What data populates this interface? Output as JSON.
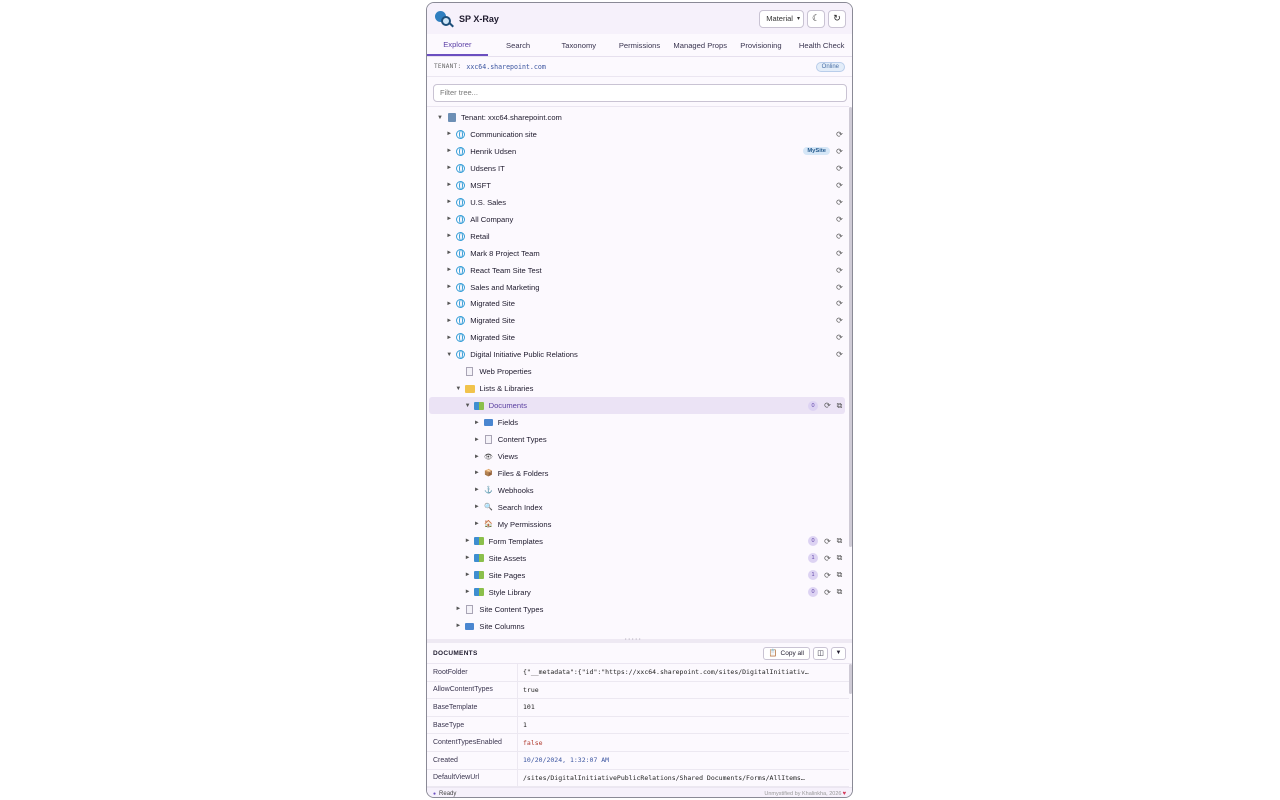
{
  "app": {
    "title": "SP X-Ray",
    "theme": "Material"
  },
  "tabs": [
    "Explorer",
    "Search",
    "Taxonomy",
    "Permissions",
    "Managed Props",
    "Provisioning",
    "Health Check"
  ],
  "tenant": {
    "label": "TENANT:",
    "url": "xxc64.sharepoint.com",
    "status": "Online"
  },
  "filter": {
    "placeholder": "Filter tree...",
    "value": ""
  },
  "tree": [
    {
      "label": "Tenant: xxc64.sharepoint.com",
      "icon": "building-icon",
      "depth": 0,
      "arrow": "▼"
    },
    {
      "label": "Communication site",
      "icon": "globe-icon",
      "depth": 1,
      "arrow": "►",
      "refresh": true
    },
    {
      "label": "Henrik Udsen",
      "icon": "globe-icon",
      "depth": 1,
      "arrow": "►",
      "refresh": true,
      "badge": "MySite"
    },
    {
      "label": "Udsens IT",
      "icon": "globe-icon",
      "depth": 1,
      "arrow": "►",
      "refresh": true
    },
    {
      "label": "MSFT",
      "icon": "globe-icon",
      "depth": 1,
      "arrow": "►",
      "refresh": true
    },
    {
      "label": "U.S. Sales",
      "icon": "globe-icon",
      "depth": 1,
      "arrow": "►",
      "refresh": true
    },
    {
      "label": "All Company",
      "icon": "globe-icon",
      "depth": 1,
      "arrow": "►",
      "refresh": true
    },
    {
      "label": "Retail",
      "icon": "globe-icon",
      "depth": 1,
      "arrow": "►",
      "refresh": true
    },
    {
      "label": "Mark 8 Project Team",
      "icon": "globe-icon",
      "depth": 1,
      "arrow": "►",
      "refresh": true
    },
    {
      "label": "React Team Site Test",
      "icon": "globe-icon",
      "depth": 1,
      "arrow": "►",
      "refresh": true
    },
    {
      "label": "Sales and Marketing",
      "icon": "globe-icon",
      "depth": 1,
      "arrow": "►",
      "refresh": true
    },
    {
      "label": "Migrated Site",
      "icon": "globe-icon",
      "depth": 1,
      "arrow": "►",
      "refresh": true
    },
    {
      "label": "Migrated Site",
      "icon": "globe-icon",
      "depth": 1,
      "arrow": "►",
      "refresh": true
    },
    {
      "label": "Migrated Site",
      "icon": "globe-icon",
      "depth": 1,
      "arrow": "►",
      "refresh": true
    },
    {
      "label": "Digital Initiative Public Relations",
      "icon": "globe-icon",
      "depth": 1,
      "arrow": "▼",
      "refresh": true
    },
    {
      "label": "Web Properties",
      "icon": "document-icon",
      "depth": 2,
      "arrow": ""
    },
    {
      "label": "Lists & Libraries",
      "icon": "folder-icon",
      "depth": 2,
      "arrow": "▼"
    },
    {
      "label": "Documents",
      "icon": "library-icon",
      "depth": 3,
      "arrow": "▼",
      "count": "0",
      "refresh": true,
      "copy": true,
      "selected": true
    },
    {
      "label": "Fields",
      "icon": "fields-icon",
      "depth": 4,
      "arrow": "►"
    },
    {
      "label": "Content Types",
      "icon": "document-icon",
      "depth": 4,
      "arrow": "►"
    },
    {
      "label": "Views",
      "icon": "eye-icon",
      "depth": 4,
      "arrow": "►"
    },
    {
      "label": "Files & Folders",
      "icon": "package-icon",
      "depth": 4,
      "arrow": "►"
    },
    {
      "label": "Webhooks",
      "icon": "hook-icon",
      "depth": 4,
      "arrow": "►"
    },
    {
      "label": "Search Index",
      "icon": "magnifier-icon",
      "depth": 4,
      "arrow": "►"
    },
    {
      "label": "My Permissions",
      "icon": "lock-house-icon",
      "depth": 4,
      "arrow": "►"
    },
    {
      "label": "Form Templates",
      "icon": "library-icon",
      "depth": 3,
      "arrow": "►",
      "count": "0",
      "refresh": true,
      "copy": true
    },
    {
      "label": "Site Assets",
      "icon": "library-icon",
      "depth": 3,
      "arrow": "►",
      "count": "1",
      "refresh": true,
      "copy": true
    },
    {
      "label": "Site Pages",
      "icon": "library-icon",
      "depth": 3,
      "arrow": "►",
      "count": "1",
      "refresh": true,
      "copy": true
    },
    {
      "label": "Style Library",
      "icon": "library-icon",
      "depth": 3,
      "arrow": "►",
      "count": "0",
      "refresh": true,
      "copy": true
    },
    {
      "label": "Site Content Types",
      "icon": "document-icon",
      "depth": 2,
      "arrow": "►"
    },
    {
      "label": "Site Columns",
      "icon": "fields-icon",
      "depth": 2,
      "arrow": "►"
    }
  ],
  "details": {
    "title": "DOCUMENTS",
    "copy_all": "Copy all",
    "properties": [
      {
        "key": "RootFolder",
        "value": "{\"__metadata\":{\"id\":\"https://xxc64.sharepoint.com/sites/DigitalInitiativ…",
        "kind": "text"
      },
      {
        "key": "AllowContentTypes",
        "value": "true",
        "kind": "text"
      },
      {
        "key": "BaseTemplate",
        "value": "101",
        "kind": "text"
      },
      {
        "key": "BaseType",
        "value": "1",
        "kind": "text"
      },
      {
        "key": "ContentTypesEnabled",
        "value": "false",
        "kind": "false"
      },
      {
        "key": "Created",
        "value": "10/20/2024, 1:32:07 AM",
        "kind": "date"
      },
      {
        "key": "DefaultViewUrl",
        "value": "/sites/DigitalInitiativePublicRelations/Shared Documents/Forms/AllItems…",
        "kind": "text"
      }
    ]
  },
  "status": {
    "text": "Ready",
    "credit": "Unmystified by Khalinkha, 2026"
  }
}
